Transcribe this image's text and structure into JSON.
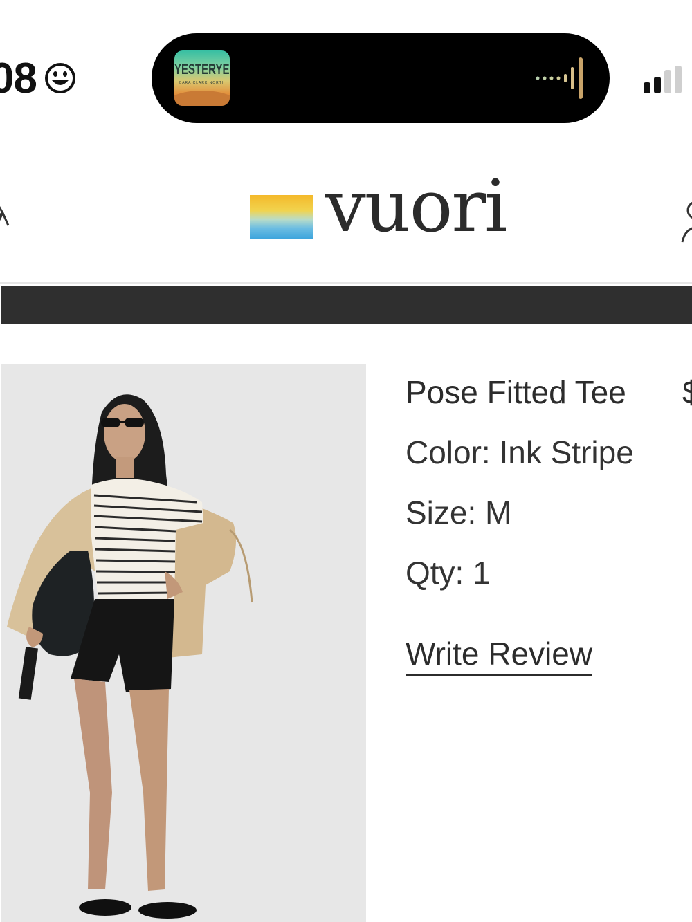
{
  "status_bar": {
    "time_fragment": "08",
    "now_playing": {
      "album_title": "YESTERYEAR",
      "album_subtitle": "CARA CLARK NORTH"
    }
  },
  "header": {
    "logo_text": "vuori",
    "brand_colors": [
      "#f4c22b",
      "#e8dc6a",
      "#9fcfe0",
      "#3ea6dd"
    ]
  },
  "promo_bar": {
    "color": "#2f2f2f"
  },
  "product": {
    "name": "Pose Fitted Tee",
    "price_fragment": "$",
    "color": "Color: Ink Stripe",
    "size": "Size: M",
    "qty": "Qty: 1",
    "review_link": "Write Review"
  },
  "icons": [
    "smiley-icon",
    "sound-wave-icon",
    "cellular-signal-icon",
    "menu-icon",
    "account-icon"
  ]
}
